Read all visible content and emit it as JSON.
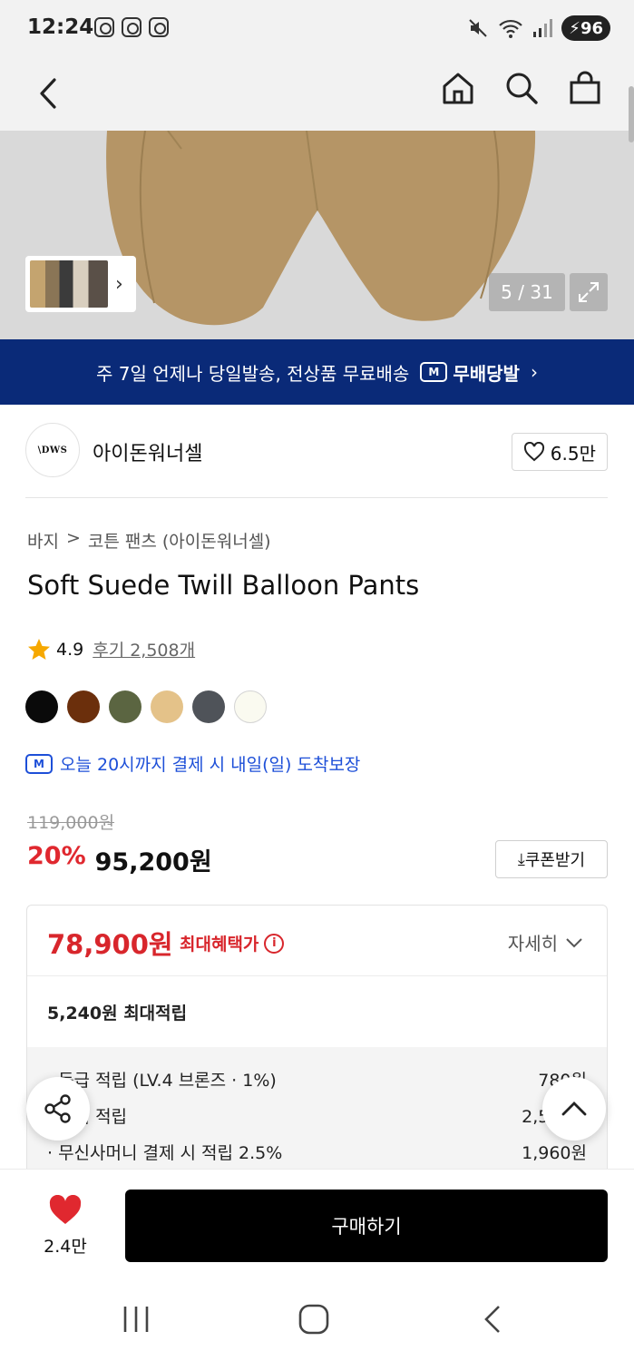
{
  "status_bar": {
    "time": "12:24",
    "battery": "96"
  },
  "product_image": {
    "counter": "5 / 31"
  },
  "promo": {
    "text": "주 7일 언제나 당일발송, 전상품 무료배송",
    "logo_badge": "M",
    "logo_text": "무배당발"
  },
  "brand": {
    "logo_text": "\\DWS",
    "name": "아이돈워너셀",
    "likes": "6.5만"
  },
  "breadcrumb": [
    "바지",
    ">",
    "코튼 팬츠 (아이돈워너셀)"
  ],
  "product": {
    "title": "Soft Suede Twill Balloon Pants",
    "rating": "4.9",
    "reviews": "후기 2,508개",
    "swatches": [
      "#0a0a0a",
      "#6b2f0c",
      "#5b6541",
      "#e4c289",
      "#4f5359",
      "#fafaf0"
    ]
  },
  "delivery": {
    "badge": "M",
    "text": "오늘 20시까지 결제 시 내일(일) 도착보장"
  },
  "price": {
    "original": "119,000원",
    "discount": "20%",
    "current": "95,200원",
    "coupon_label": "쿠폰받기"
  },
  "benefits": {
    "max_price": "78,900원",
    "max_label": "최대혜택가",
    "detail_label": "자세히",
    "points_total": "5,240원 최대적립",
    "items": [
      {
        "label": "· 등급 적립 (LV.4 브론즈 · 1%)",
        "value": "780원"
      },
      {
        "label": "· 후기 적립",
        "value": "2,500원"
      },
      {
        "label": "· 무신사머니 결제 시 적립 2.5%",
        "value": "1,960원"
      }
    ]
  },
  "bottom_bar": {
    "wish_count": "2.4만",
    "buy_label": "구매하기"
  },
  "colors": {
    "navy": "#0a2a78",
    "sale_red": "#e0282f",
    "link_blue": "#1d4fd8"
  }
}
